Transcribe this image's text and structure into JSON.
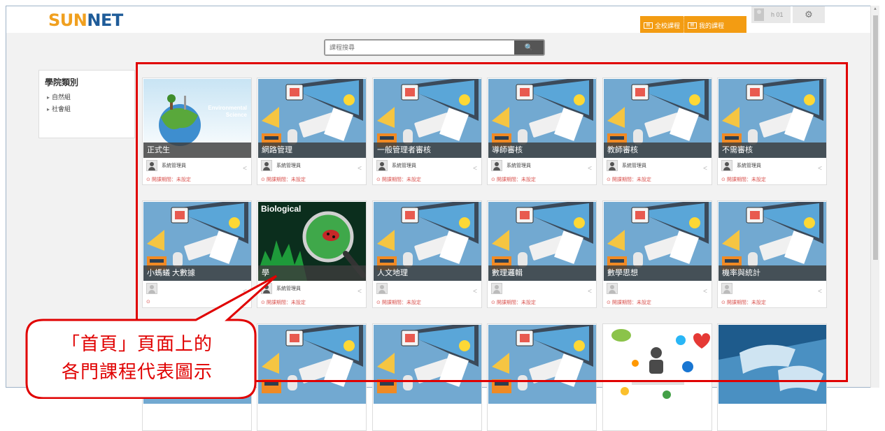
{
  "header": {
    "logo_a": "SUN",
    "logo_b": "NET",
    "tabs": [
      "全校課程",
      "我的課程"
    ],
    "user": "h 01"
  },
  "search": {
    "placeholder": "課程搜尋",
    "button": "🔍"
  },
  "sidebar": {
    "title": "學院類別",
    "items": [
      "自然組",
      "社會組"
    ]
  },
  "courses": [
    {
      "title": "正式生",
      "owner": "系統管理員",
      "period": "開課期間：未設定",
      "thumb": "environmental"
    },
    {
      "title": "網路管理",
      "owner": "系統管理員",
      "period": "開課期間：未設定",
      "thumb": "desk"
    },
    {
      "title": "一般管理者審核",
      "owner": "系統管理員",
      "period": "開課期間：未設定",
      "thumb": "desk"
    },
    {
      "title": "導師審核",
      "owner": "系統管理員",
      "period": "開課期間：未設定",
      "thumb": "desk"
    },
    {
      "title": "教師審核",
      "owner": "系統管理員",
      "period": "開課期間：未設定",
      "thumb": "desk"
    },
    {
      "title": "不需審核",
      "owner": "系統管理員",
      "period": "開課期間：未設定",
      "thumb": "desk"
    },
    {
      "title": "小螞蟻 大數據",
      "owner": "",
      "period": "",
      "thumb": "desk"
    },
    {
      "title": "學",
      "owner": "系統管理員",
      "period": "開課期間：未設定",
      "thumb": "bio"
    },
    {
      "title": "人文地理",
      "owner": "",
      "period": "開課期間：未設定",
      "thumb": "desk"
    },
    {
      "title": "數理邏輯",
      "owner": "",
      "period": "開課期間：未設定",
      "thumb": "desk"
    },
    {
      "title": "數學思想",
      "owner": "",
      "period": "開課期間：未設定",
      "thumb": "desk"
    },
    {
      "title": "機率與統計",
      "owner": "",
      "period": "開課期間：未設定",
      "thumb": "desk"
    },
    {
      "title": "",
      "owner": "",
      "period": "",
      "thumb": "desk"
    },
    {
      "title": "",
      "owner": "",
      "period": "",
      "thumb": "desk"
    },
    {
      "title": "",
      "owner": "",
      "period": "",
      "thumb": "desk"
    },
    {
      "title": "",
      "owner": "",
      "period": "",
      "thumb": "desk"
    },
    {
      "title": "",
      "owner": "",
      "period": "",
      "thumb": "social"
    },
    {
      "title": "",
      "owner": "",
      "period": "",
      "thumb": "typing"
    }
  ],
  "thumb_labels": {
    "environmental_a": "Environmental",
    "environmental_b": "Science",
    "bio": "Biological"
  },
  "callout": {
    "line1": "「首頁」頁面上的",
    "line2": "各門課程代表圖示"
  },
  "colors": {
    "accent": "#f39c12",
    "highlight": "#e00000",
    "thumb_sky": "#6fa7cf"
  }
}
